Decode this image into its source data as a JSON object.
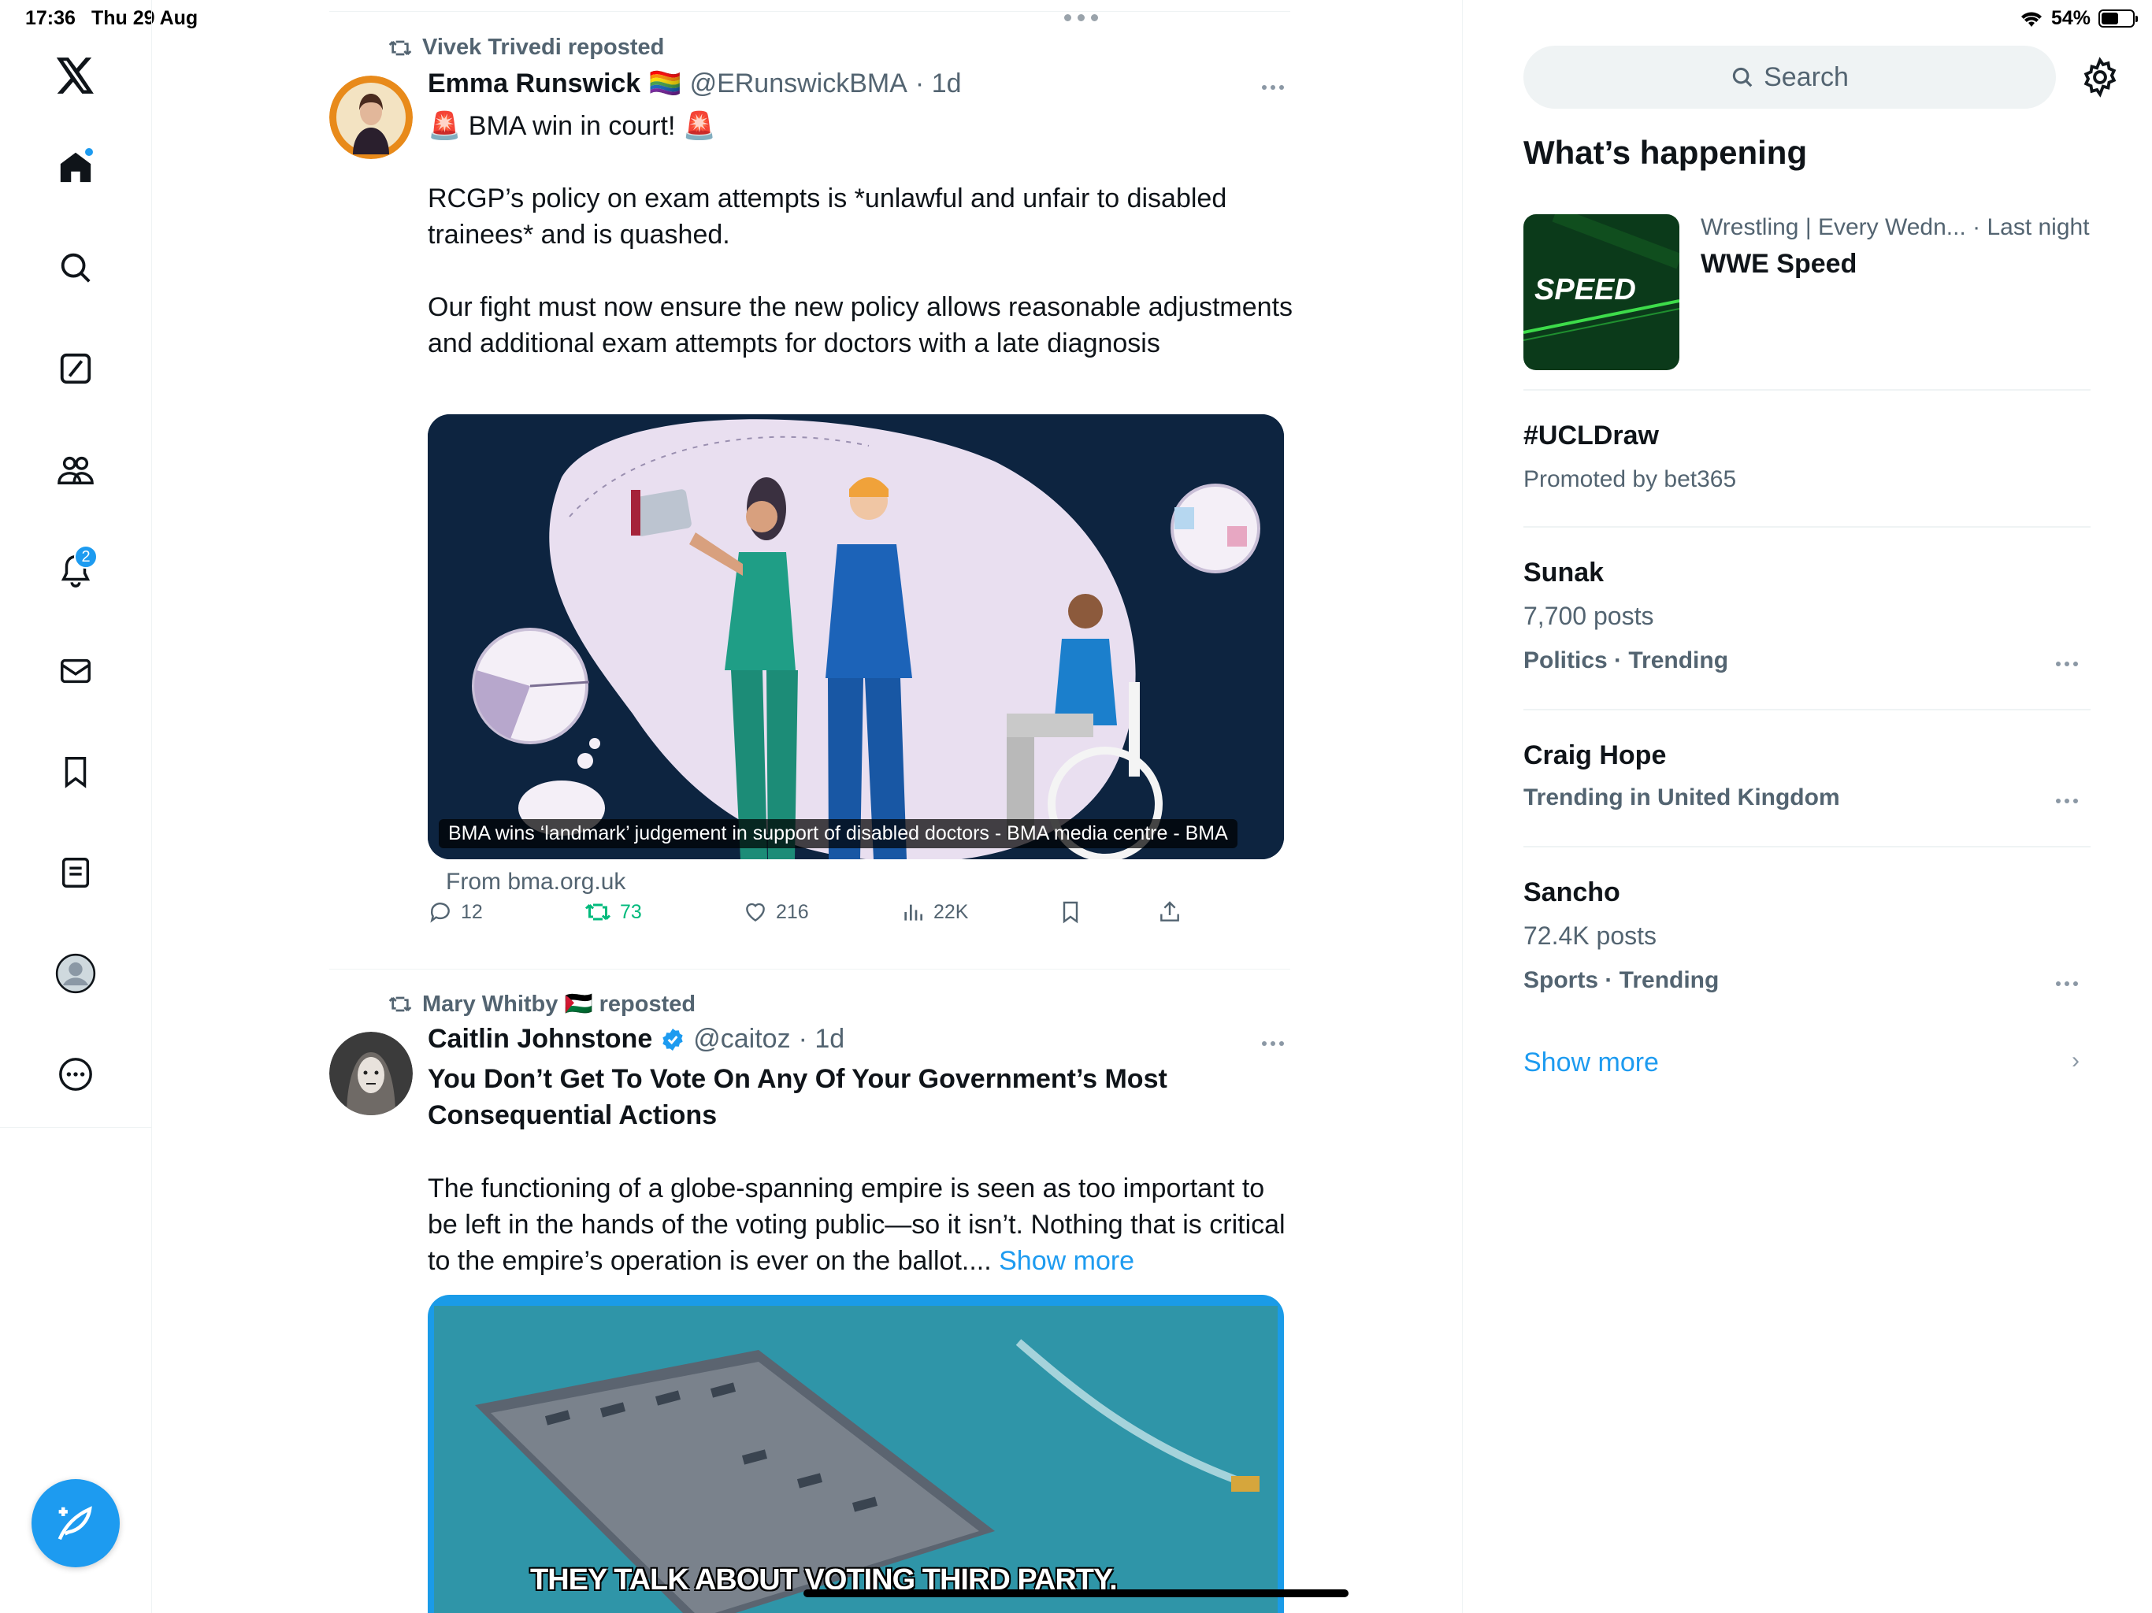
{
  "status_bar": {
    "time": "17:36",
    "date": "Thu 29 Aug",
    "battery_percent": "54%",
    "battery_level": 0.54
  },
  "nav": {
    "notifications_badge": "2",
    "items": [
      "home",
      "explore",
      "grok",
      "communities",
      "notifications",
      "messages",
      "bookmarks",
      "lists",
      "profile",
      "more"
    ]
  },
  "tweets": [
    {
      "repost_by": "Vivek Trivedi reposted",
      "name": "Emma Runswick",
      "name_emoji": "🏳️‍🌈",
      "handle": "@ERunswickBMA",
      "time": "· 1d",
      "text": "🚨 BMA win in court! 🚨\n\nRCGP’s policy on exam attempts is *unlawful and unfair to disabled trainees* and is quashed.\n\nOur fight must now ensure the new policy allows  reasonable adjustments and additional exam attempts for doctors with a late diagnosis",
      "card_caption": "BMA wins ‘landmark’ judgement in support of disabled doctors - BMA media centre - BMA",
      "card_from": "From bma.org.uk",
      "replies": "12",
      "reposts": "73",
      "likes": "216",
      "views": "22K"
    },
    {
      "repost_by": "Mary Whitby 🇵🇸 reposted",
      "name": "Caitlin Johnstone",
      "handle": "@caitoz",
      "time": "· 1d",
      "title": "You Don’t Get To Vote On Any Of Your Government’s Most Consequential Actions",
      "text": "The functioning of a globe-spanning empire is seen as too important to be left in the hands of the voting public—so it isn’t. Nothing that is critical to the empire’s operation is ever on the ballot.... ",
      "show_more": "Show more",
      "video_caption": "THEY TALK ABOUT VOTING THIRD PARTY,"
    }
  ],
  "right": {
    "search_placeholder": "Search",
    "heading": "What’s happening",
    "trends": [
      {
        "meta": "Wrestling | Every Wedn... · Last night",
        "title": "WWE Speed",
        "thumb_text": "SPEED"
      },
      {
        "title": "#UCLDraw",
        "sub": "Promoted by bet365"
      },
      {
        "title": "Sunak",
        "sub": "7,700 posts",
        "ctx": "Politics · Trending"
      },
      {
        "title": "Craig Hope",
        "ctx": "Trending in United Kingdom"
      },
      {
        "title": "Sancho",
        "sub": "72.4K posts",
        "ctx": "Sports · Trending"
      }
    ],
    "show_more": "Show more"
  }
}
